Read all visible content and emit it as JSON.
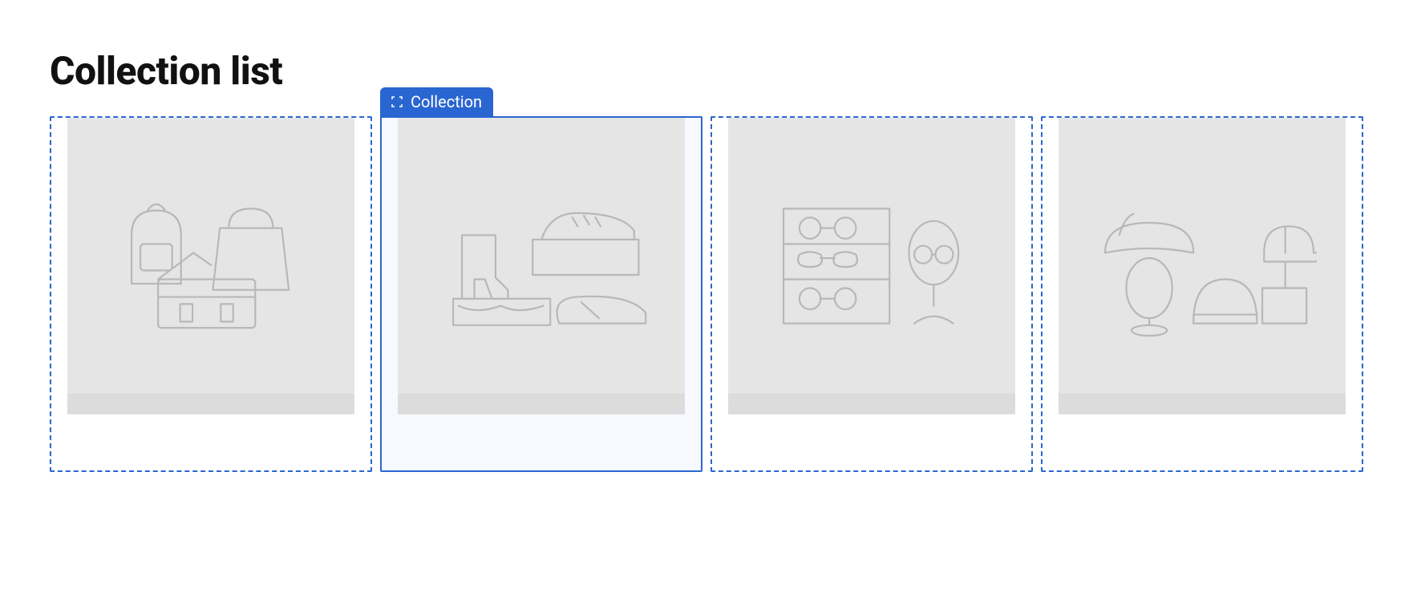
{
  "section": {
    "title": "Collection list",
    "selected_block_label": "Collection",
    "items": [
      {
        "kind": "bags",
        "selected": false
      },
      {
        "kind": "shoes",
        "selected": true
      },
      {
        "kind": "glasses",
        "selected": false
      },
      {
        "kind": "hats",
        "selected": false
      }
    ]
  },
  "colors": {
    "accent": "#2a66d1",
    "placeholder_bg": "#e5e5e5",
    "selected_bg": "#f6f9ff"
  }
}
